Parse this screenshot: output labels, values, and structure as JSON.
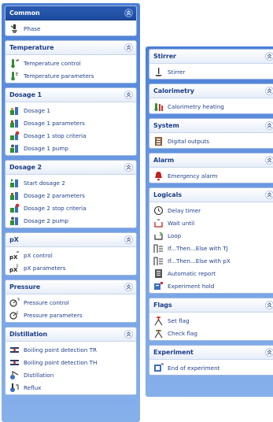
{
  "left_column": [
    {
      "title": "Common",
      "selected": true,
      "items": [
        {
          "label": "Phase",
          "icon": "phase-icon"
        }
      ]
    },
    {
      "title": "Temperature",
      "items": [
        {
          "label": "Temperature control",
          "icon": "temperature-control-icon"
        },
        {
          "label": "Temperature parameters",
          "icon": "temperature-parameters-icon"
        }
      ]
    },
    {
      "title": "Dosage 1",
      "items": [
        {
          "label": "Dosage 1",
          "icon": "dosage-icon"
        },
        {
          "label": "Dosage 1 parameters",
          "icon": "dosage-parameters-icon"
        },
        {
          "label": "Dosage 1 stop criteria",
          "icon": "dosage-stop-criteria-icon"
        },
        {
          "label": "Dosage 1 pump",
          "icon": "dosage-pump-icon"
        }
      ]
    },
    {
      "title": "Dosage 2",
      "items": [
        {
          "label": "Start dosage 2",
          "icon": "start-dosage-icon"
        },
        {
          "label": "Dosage 2 parameters",
          "icon": "dosage-parameters-icon"
        },
        {
          "label": "Dosage 2 stop criteria",
          "icon": "dosage-stop-criteria-icon"
        },
        {
          "label": "Dosage 2 pump",
          "icon": "dosage-pump-icon"
        }
      ]
    },
    {
      "title": "pX",
      "items": [
        {
          "label": "pX control",
          "icon": "px-control-icon"
        },
        {
          "label": "pX parameters",
          "icon": "px-parameters-icon"
        }
      ]
    },
    {
      "title": "Pressure",
      "items": [
        {
          "label": "Pressure control",
          "icon": "pressure-control-icon"
        },
        {
          "label": "Pressure parameters",
          "icon": "pressure-parameters-icon"
        }
      ]
    },
    {
      "title": "Distillation",
      "items": [
        {
          "label": "Boiling point detection TR",
          "icon": "boiling-point-icon"
        },
        {
          "label": "Boiling point detection TH",
          "icon": "boiling-point-icon"
        },
        {
          "label": "Distillation",
          "icon": "distillation-icon"
        },
        {
          "label": "Reflux",
          "icon": "reflux-icon"
        }
      ]
    }
  ],
  "right_column": [
    {
      "title": "Stirrer",
      "items": [
        {
          "label": "Stirrer",
          "icon": "stirrer-icon"
        }
      ]
    },
    {
      "title": "Calorimetry",
      "items": [
        {
          "label": "Calorimetry heating",
          "icon": "calorimetry-heating-icon"
        }
      ]
    },
    {
      "title": "System",
      "items": [
        {
          "label": "Digital outputs",
          "icon": "digital-outputs-icon"
        }
      ]
    },
    {
      "title": "Alarm",
      "items": [
        {
          "label": "Emergency alarm",
          "icon": "alarm-bell-icon"
        }
      ]
    },
    {
      "title": "Logicals",
      "items": [
        {
          "label": "Delay timer",
          "icon": "clock-icon"
        },
        {
          "label": "Wait until",
          "icon": "wait-until-icon"
        },
        {
          "label": "Loop",
          "icon": "loop-icon"
        },
        {
          "label": "If...Then...Else with TJ",
          "icon": "if-then-else-icon"
        },
        {
          "label": "If...Then...Else with pX",
          "icon": "if-then-else-icon"
        },
        {
          "label": "Automatic report",
          "icon": "report-icon"
        },
        {
          "label": "Experiment hold",
          "icon": "experiment-hold-icon"
        }
      ]
    },
    {
      "title": "Flags",
      "items": [
        {
          "label": "Set flag",
          "icon": "set-flag-icon"
        },
        {
          "label": "Check flag",
          "icon": "check-flag-icon"
        }
      ]
    },
    {
      "title": "Experiment",
      "items": [
        {
          "label": "End of experiment",
          "icon": "end-experiment-icon"
        }
      ]
    }
  ],
  "colors": {
    "panel_gradient_top": "#4b7fd6",
    "panel_gradient_bottom": "#86b0ea",
    "header_text": "#1d3e86",
    "item_text": "#1f3f8a",
    "selected_header": "#2a5bb3"
  }
}
